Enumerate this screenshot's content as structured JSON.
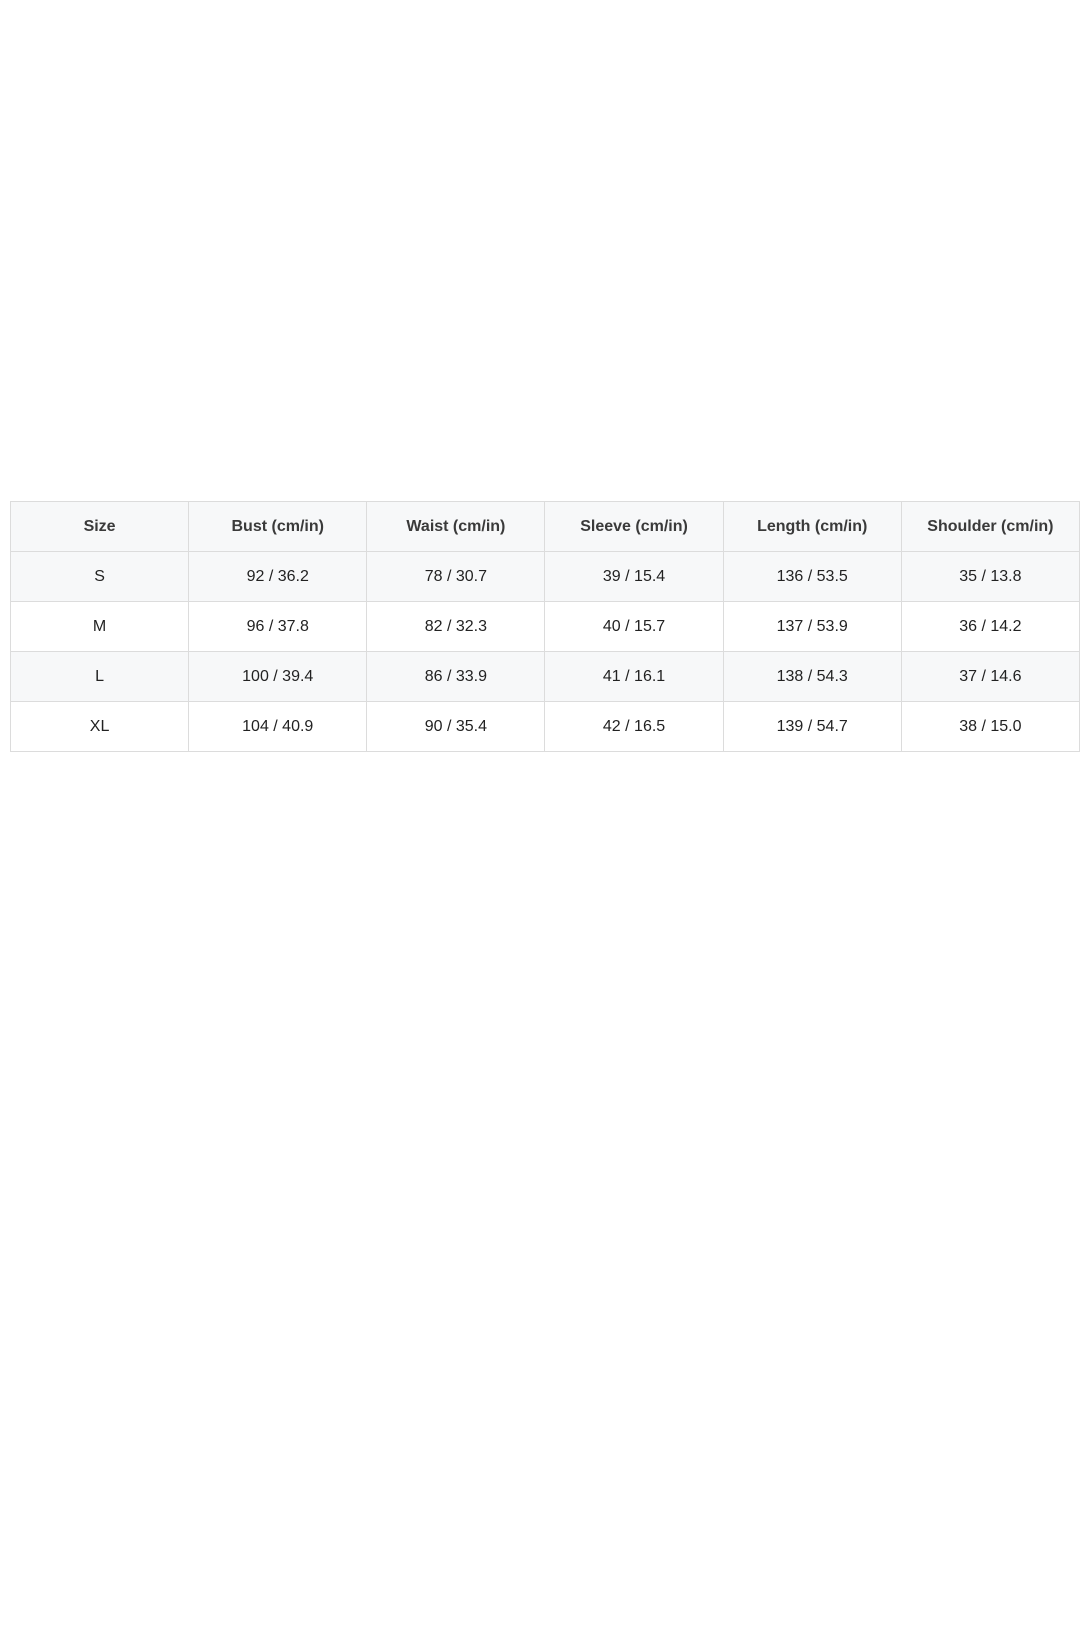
{
  "size_chart": {
    "headers": [
      "Size",
      "Bust (cm/in)",
      "Waist (cm/in)",
      "Sleeve (cm/in)",
      "Length (cm/in)",
      "Shoulder (cm/in)"
    ],
    "rows": [
      [
        "S",
        "92 / 36.2",
        "78 / 30.7",
        "39 / 15.4",
        "136 / 53.5",
        "35 / 13.8"
      ],
      [
        "M",
        "96 / 37.8",
        "82 / 32.3",
        "40 / 15.7",
        "137 / 53.9",
        "36 / 14.2"
      ],
      [
        "L",
        "100 / 39.4",
        "86 / 33.9",
        "41 / 16.1",
        "138 / 54.3",
        "37 / 14.6"
      ],
      [
        "XL",
        "104 / 40.9",
        "90 / 35.4",
        "42 / 16.5",
        "139 / 54.7",
        "38 / 15.0"
      ]
    ]
  }
}
